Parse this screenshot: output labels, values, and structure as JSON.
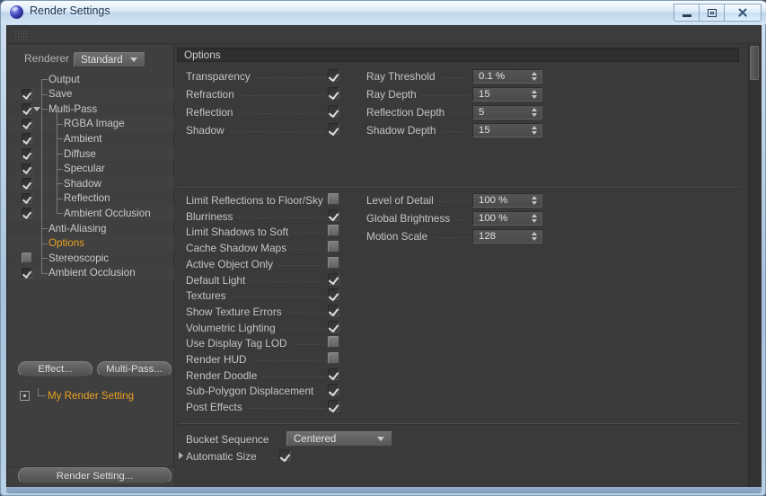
{
  "window": {
    "title": "Render Settings",
    "icon": "c4d-sphere-icon",
    "controls": {
      "minimize": "minimize-icon",
      "maximize": "restore-icon",
      "close": "close-icon"
    }
  },
  "left_panel": {
    "renderer_label": "Renderer",
    "renderer_value": "Standard",
    "tree": [
      {
        "label": "Output",
        "checkbox": "none",
        "indent": 1,
        "selected": false
      },
      {
        "label": "Save",
        "checkbox": "checked",
        "indent": 1,
        "selected": false
      },
      {
        "label": "Multi-Pass",
        "checkbox": "checked",
        "indent": 1,
        "selected": false,
        "expander": "down"
      },
      {
        "label": "RGBA Image",
        "checkbox": "checked",
        "indent": 2,
        "selected": false
      },
      {
        "label": "Ambient",
        "checkbox": "checked",
        "indent": 2,
        "selected": false
      },
      {
        "label": "Diffuse",
        "checkbox": "checked",
        "indent": 2,
        "selected": false
      },
      {
        "label": "Specular",
        "checkbox": "checked",
        "indent": 2,
        "selected": false
      },
      {
        "label": "Shadow",
        "checkbox": "checked",
        "indent": 2,
        "selected": false
      },
      {
        "label": "Reflection",
        "checkbox": "checked",
        "indent": 2,
        "selected": false
      },
      {
        "label": "Ambient Occlusion",
        "checkbox": "checked",
        "indent": 2,
        "selected": false
      },
      {
        "label": "Anti-Aliasing",
        "checkbox": "none",
        "indent": 1,
        "selected": false
      },
      {
        "label": "Options",
        "checkbox": "none",
        "indent": 1,
        "selected": true
      },
      {
        "label": "Stereoscopic",
        "checkbox": "unchecked",
        "indent": 1,
        "selected": false
      },
      {
        "label": "Ambient Occlusion",
        "checkbox": "checked",
        "indent": 1,
        "selected": false
      }
    ],
    "effect_button": "Effect...",
    "multipass_button": "Multi-Pass...",
    "render_setting_name": "My Render Setting",
    "render_setting_button": "Render Setting..."
  },
  "options_panel": {
    "title": "Options",
    "group1": [
      {
        "label": "Transparency",
        "state": "checked"
      },
      {
        "label": "Refraction",
        "state": "checked"
      },
      {
        "label": "Reflection",
        "state": "checked"
      },
      {
        "label": "Shadow",
        "state": "checked"
      }
    ],
    "group2": [
      {
        "label": "Limit Reflections to Floor/Sky",
        "state": "unchecked"
      },
      {
        "label": "Blurriness",
        "state": "checked"
      },
      {
        "label": "Limit Shadows to Soft",
        "state": "unchecked"
      },
      {
        "label": "Cache Shadow Maps",
        "state": "unchecked"
      },
      {
        "label": "Active Object Only",
        "state": "unchecked"
      },
      {
        "label": "Default Light",
        "state": "checked"
      },
      {
        "label": "Textures",
        "state": "checked"
      },
      {
        "label": "Show Texture Errors",
        "state": "checked"
      },
      {
        "label": "Volumetric Lighting",
        "state": "checked"
      },
      {
        "label": "Use Display Tag LOD",
        "state": "unchecked"
      },
      {
        "label": "Render HUD",
        "state": "unchecked"
      },
      {
        "label": "Render Doodle",
        "state": "checked"
      },
      {
        "label": "Sub-Polygon Displacement",
        "state": "checked"
      },
      {
        "label": "Post Effects",
        "state": "checked"
      }
    ],
    "numeric_group1": [
      {
        "label": "Ray Threshold",
        "value": "0.1 %"
      },
      {
        "label": "Ray Depth",
        "value": "15"
      },
      {
        "label": "Reflection Depth",
        "value": "5"
      },
      {
        "label": "Shadow Depth",
        "value": "15"
      }
    ],
    "numeric_group2": [
      {
        "label": "Level of Detail",
        "value": "100 %"
      },
      {
        "label": "Global Brightness",
        "value": "100 %"
      },
      {
        "label": "Motion Scale",
        "value": "128"
      }
    ],
    "bucket_label": "Bucket Sequence",
    "bucket_value": "Centered",
    "automatic_size_label": "Automatic Size",
    "automatic_size_state": "checked"
  },
  "colors": {
    "accent_orange": "#e8a020",
    "panel_bg": "#3a3a3a",
    "aero_blue": "#b6cde3"
  }
}
